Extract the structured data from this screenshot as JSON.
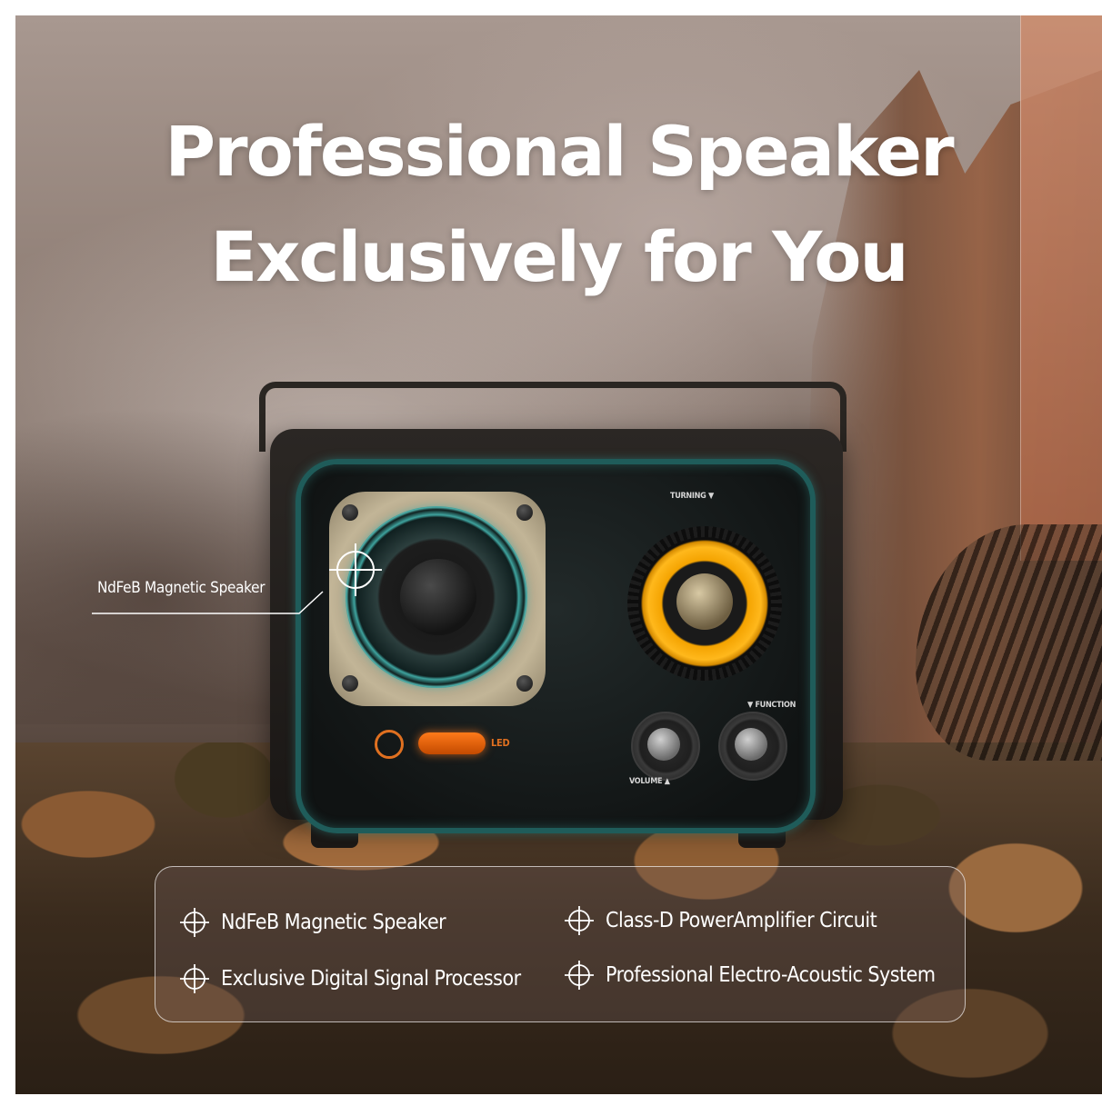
{
  "headline": {
    "line1": "Professional Speaker",
    "line2": "Exclusively for You"
  },
  "callout": {
    "label": "NdFeB Magnetic Speaker"
  },
  "speaker_labels": {
    "turning": "TURNING ▼",
    "function": "▼ FUNCTION",
    "volume": "VOLUME ▲",
    "led": "LED"
  },
  "features": [
    {
      "label": "NdFeB Magnetic Speaker",
      "icon": "crosshair-icon"
    },
    {
      "label": "Class-D PowerAmplifier Circuit",
      "icon": "crosshair-icon"
    },
    {
      "label": "Exclusive Digital Signal Processor",
      "icon": "crosshair-icon"
    },
    {
      "label": "Professional Electro-Acoustic System",
      "icon": "crosshair-icon"
    }
  ],
  "colors": {
    "accent_teal": "#1f5c5a",
    "tweeter_yellow": "#ffb81c",
    "led_orange": "#ff7a1a",
    "text": "#ffffff"
  }
}
